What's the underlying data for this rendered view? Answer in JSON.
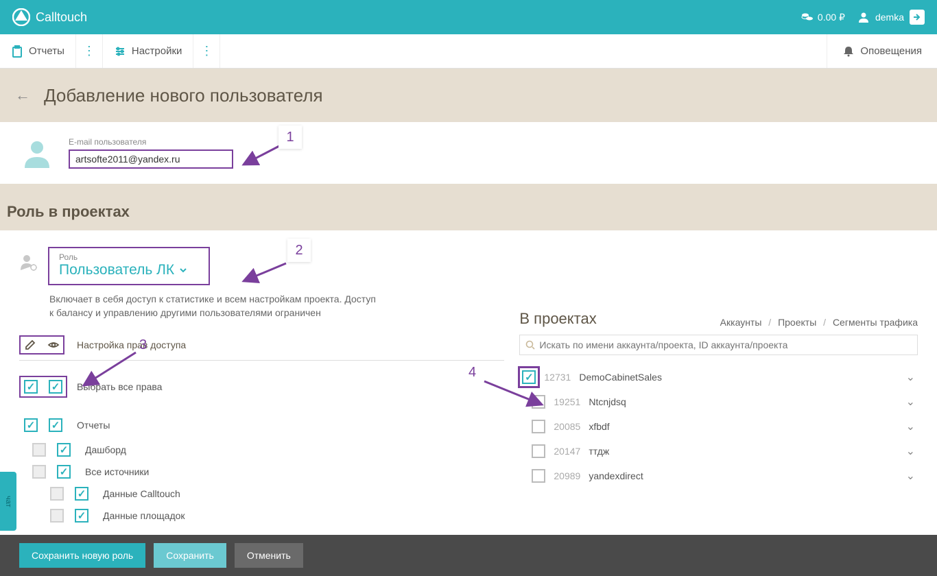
{
  "brand": "Calltouch",
  "balance": "0.00 ₽",
  "username": "demka",
  "nav": {
    "reports": "Отчеты",
    "settings": "Настройки",
    "notifications": "Оповещения"
  },
  "page_title": "Добавление нового пользователя",
  "email_label": "E-mail пользователя",
  "email_value": "artsofte2011@yandex.ru",
  "section_roles": "Роль в проектах",
  "role": {
    "label": "Роль",
    "value": "Пользователь ЛК",
    "description": "Включает в себя доступ к статистике и всем настройкам проекта. Доступ к балансу и управлению другими пользователями ограничен"
  },
  "perm_header": "Настройка прав доступа",
  "perms": {
    "select_all": "Выбрать все права",
    "reports": "Отчеты",
    "dashboard": "Дашборд",
    "all_sources": "Все источники",
    "calltouch_data": "Данные Calltouch",
    "platform_data": "Данные площадок"
  },
  "projects_title": "В проектах",
  "breadcrumb": {
    "accounts": "Аккаунты",
    "projects": "Проекты",
    "segments": "Сегменты трафика"
  },
  "search_placeholder": "Искать по имени аккаунта/проекта, ID аккаунта/проекта",
  "projects": [
    {
      "id": "12731",
      "name": "DemoCabinetSales",
      "checked": true,
      "top": true
    },
    {
      "id": "19251",
      "name": "Ntcnjdsq",
      "checked": false
    },
    {
      "id": "20085",
      "name": "xfbdf",
      "checked": false
    },
    {
      "id": "20147",
      "name": "ттдж",
      "checked": false
    },
    {
      "id": "20989",
      "name": "yandexdirect",
      "checked": false
    }
  ],
  "footer": {
    "save_role": "Сохранить новую роль",
    "save": "Сохранить",
    "cancel": "Отменить"
  },
  "annotations": {
    "n1": "1",
    "n2": "2",
    "n3": "3",
    "n4": "4"
  },
  "side_tab": "чат"
}
